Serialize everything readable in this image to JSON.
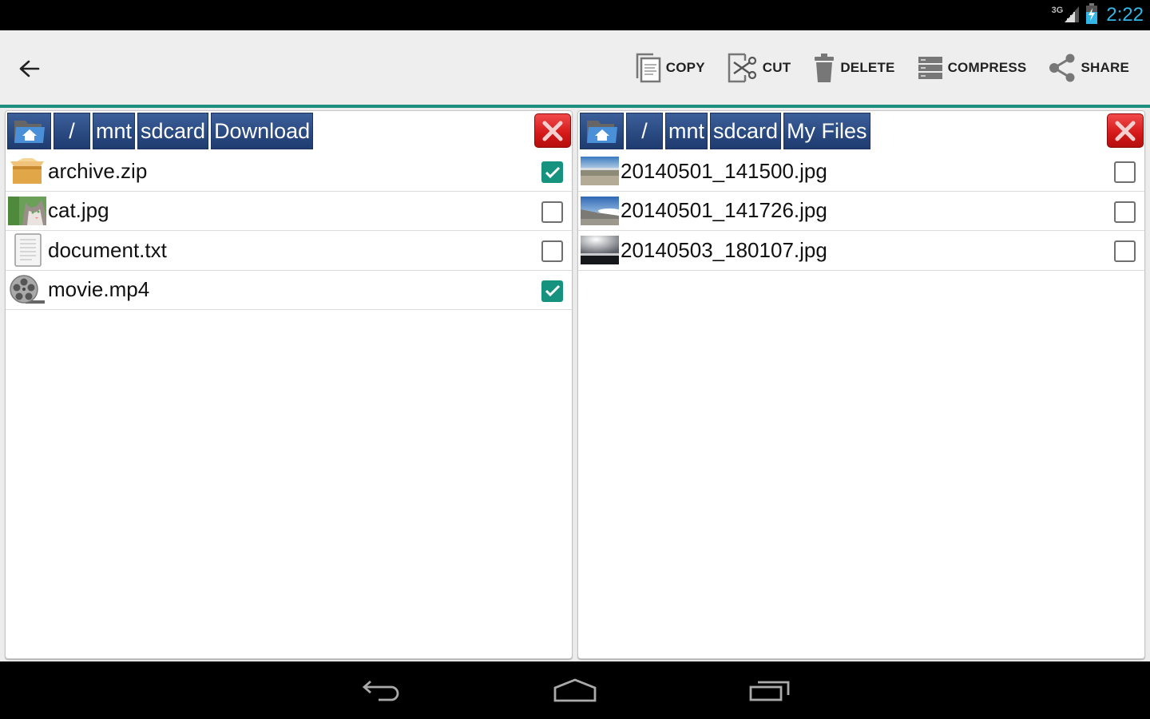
{
  "status_bar": {
    "network": "3G",
    "time": "2:22"
  },
  "action_bar": {
    "back_icon": "arrow-back-icon",
    "actions": [
      {
        "label": "COPY",
        "icon": "copy-icon"
      },
      {
        "label": "CUT",
        "icon": "scissors-icon"
      },
      {
        "label": "DELETE",
        "icon": "trash-icon"
      },
      {
        "label": "COMPRESS",
        "icon": "compress-icon"
      },
      {
        "label": "SHARE",
        "icon": "share-icon"
      }
    ]
  },
  "colors": {
    "accent": "#1e8f7f",
    "checkbox_checked": "#16937f",
    "clock": "#33b5e5",
    "crumb_bg": "#2a4a82",
    "close_red": "#d41818"
  },
  "left_panel": {
    "breadcrumb": [
      "/",
      "mnt",
      "sdcard",
      "Download"
    ],
    "files": [
      {
        "name": "archive.zip",
        "type": "archive",
        "checked": true
      },
      {
        "name": "cat.jpg",
        "type": "image",
        "checked": false
      },
      {
        "name": "document.txt",
        "type": "text",
        "checked": false
      },
      {
        "name": "movie.mp4",
        "type": "video",
        "checked": true
      }
    ]
  },
  "right_panel": {
    "breadcrumb": [
      "/",
      "mnt",
      "sdcard",
      "My Files"
    ],
    "files": [
      {
        "name": "20140501_141500.jpg",
        "type": "image",
        "checked": false
      },
      {
        "name": "20140501_141726.jpg",
        "type": "image",
        "checked": false
      },
      {
        "name": "20140503_180107.jpg",
        "type": "image",
        "checked": false
      }
    ]
  },
  "nav_bar": {
    "buttons": [
      "back",
      "home",
      "recent-apps"
    ]
  }
}
